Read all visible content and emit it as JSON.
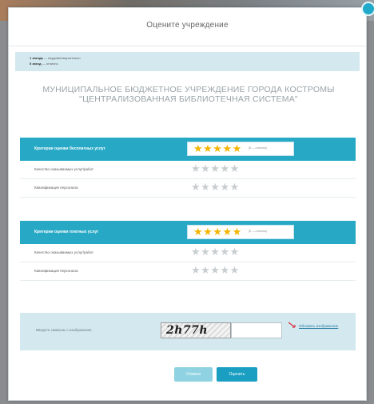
{
  "modal": {
    "title": "Оцените учреждение"
  },
  "legend": [
    {
      "key": "1 звезда",
      "text": "— неудовлетворительно"
    },
    {
      "key": "5 звезд",
      "text": "— отлично"
    }
  ],
  "organization": {
    "line1": "МУНИЦИПАЛЬНОЕ БЮДЖЕТНОЕ УЧРЕЖДЕНИЕ ГОРОДА КОСТРОМЫ",
    "line2": "\"ЦЕНТРАЛИЗОВАННАЯ БИБЛИОТЕЧНАЯ СИСТЕМА\""
  },
  "sections": [
    {
      "header": "Критерии оценки бесплатных услуг",
      "overall_stars": 5,
      "overall_note": "(5 — отлично)",
      "criteria": [
        {
          "label": "Качество оказываемых услуг/работ",
          "stars": 0
        },
        {
          "label": "Квалификация персонала",
          "stars": 0
        }
      ]
    },
    {
      "header": "Критерии оценки платных услуг",
      "overall_stars": 5,
      "overall_note": "(5 — отлично)",
      "criteria": [
        {
          "label": "Качество оказываемых услуг/работ",
          "stars": 0
        },
        {
          "label": "Квалификация персонала",
          "stars": 0
        }
      ]
    }
  ],
  "captcha": {
    "label": "Введите символы с изображения",
    "image_text": "2h77h",
    "input_value": "",
    "refresh_label": "Обновить изображение"
  },
  "buttons": {
    "cancel": "Отмена",
    "submit": "Оценить"
  },
  "colors": {
    "accent": "#27a9c6",
    "star_filled": "#f4b400",
    "star_empty": "#c8cdd0",
    "panel": "#d3e9ef"
  }
}
